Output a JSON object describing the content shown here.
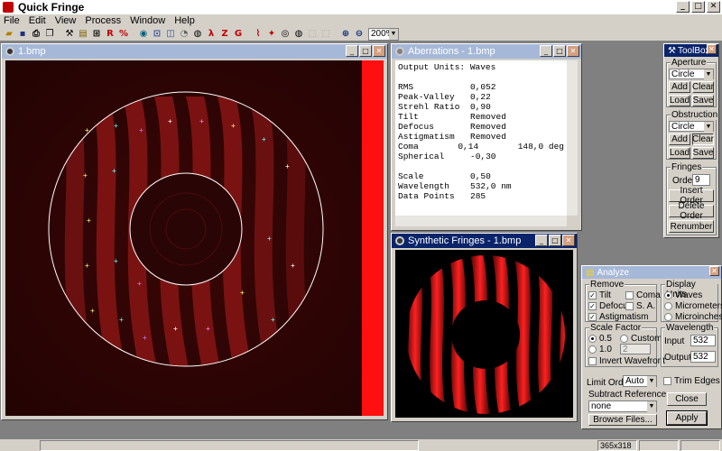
{
  "app": {
    "title": "Quick Fringe"
  },
  "menu": [
    "File",
    "Edit",
    "View",
    "Process",
    "Window",
    "Help"
  ],
  "toolbar": {
    "zoom": "200%",
    "letters": [
      "R",
      "Z",
      "G"
    ]
  },
  "image_window": {
    "title": "1.bmp"
  },
  "aberrations": {
    "title": "Aberrations - 1.bmp",
    "units_line": "Output Units: Waves",
    "rows": [
      {
        "k": "RMS",
        "v": "0,052",
        "x": ""
      },
      {
        "k": "Peak-Valley",
        "v": "0,22",
        "x": ""
      },
      {
        "k": "Strehl Ratio",
        "v": "0,90",
        "x": ""
      },
      {
        "k": "Tilt",
        "v": "Removed",
        "x": ""
      },
      {
        "k": "Defocus",
        "v": "Removed",
        "x": ""
      },
      {
        "k": "Astigmatism",
        "v": "Removed",
        "x": ""
      },
      {
        "k": "Coma",
        "v": "0,14",
        "x": "148,0 deg"
      },
      {
        "k": "Spherical",
        "v": "-0,30",
        "x": ""
      }
    ],
    "rows2": [
      {
        "k": "Scale",
        "v": "0,50"
      },
      {
        "k": "Wavelength",
        "v": "532,0 nm"
      },
      {
        "k": "Data Points",
        "v": "285"
      }
    ]
  },
  "synthetic": {
    "title": "Synthetic Fringes - 1.bmp"
  },
  "toolbox": {
    "title": "ToolBox",
    "aperture": {
      "title": "Aperture",
      "shape": "Circle",
      "add": "Add",
      "clear": "Clear",
      "load": "Load",
      "save": "Save"
    },
    "obstruction": {
      "title": "Obstruction",
      "shape": "Circle",
      "add": "Add",
      "clear": "Clear",
      "load": "Load",
      "save": "Save"
    },
    "fringes": {
      "title": "Fringes",
      "order_label": "Order",
      "order_value": "9",
      "insert": "Insert Order",
      "delete": "Delete Order",
      "renumber": "Renumber"
    }
  },
  "analyze": {
    "title": "Analyze",
    "remove": {
      "title": "Remove",
      "tilt": "Tilt",
      "coma": "Coma",
      "defocus": "Defocus",
      "sa": "S. A.",
      "astig": "Astigmatism"
    },
    "display_units": {
      "title": "Display Units",
      "waves": "Waves",
      "micrometers": "Micrometers",
      "microinches": "Microinches"
    },
    "scale": {
      "title": "Scale Factor",
      "half": "0.5",
      "custom": "Custom",
      "one": "1.0",
      "custom_value": "2",
      "invert": "Invert Wavefront"
    },
    "wavelength": {
      "title": "Wavelength",
      "input_label": "Input",
      "input_value": "532",
      "output_label": "Output",
      "output_value": "532"
    },
    "limit_order": {
      "label": "Limit Order",
      "value": "Auto"
    },
    "trim": "Trim Edges",
    "subtract": {
      "title": "Subtract Reference",
      "value": "none",
      "browse": "Browse Files..."
    },
    "close": "Close",
    "apply": "Apply"
  },
  "status": {
    "size": "365x318"
  }
}
